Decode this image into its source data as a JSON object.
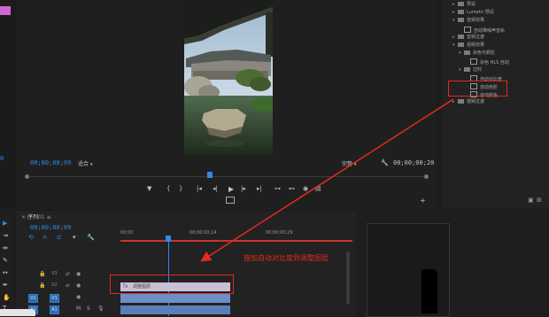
{
  "program": {
    "timecode_left": "00;00;00;09",
    "fit_label": "适合",
    "full_label": "完整",
    "timecode_right": "00;00;00;20"
  },
  "effects_panel": {
    "items": [
      {
        "indent": 1,
        "type": "folder",
        "label": "预设"
      },
      {
        "indent": 1,
        "type": "folder",
        "label": "Lumetri 预设"
      },
      {
        "indent": 1,
        "type": "folder-open",
        "label": "音频效果"
      },
      {
        "indent": 2,
        "type": "file",
        "label": "自动降噪声音轨"
      },
      {
        "indent": 1,
        "type": "folder",
        "label": "音频过渡"
      },
      {
        "indent": 1,
        "type": "folder-open",
        "label": "视频效果"
      },
      {
        "indent": 2,
        "type": "folder-open",
        "label": "杂色与颗粒"
      },
      {
        "indent": 3,
        "type": "file",
        "label": "杂色 HLS 自动"
      },
      {
        "indent": 2,
        "type": "folder-open",
        "label": "过时"
      },
      {
        "indent": 3,
        "type": "file",
        "label": "自动对比度"
      },
      {
        "indent": 3,
        "type": "file",
        "label": "自动色阶"
      },
      {
        "indent": 3,
        "type": "file",
        "label": "自动颜色"
      },
      {
        "indent": 1,
        "type": "folder",
        "label": "视频过渡"
      }
    ]
  },
  "timeline": {
    "sequence_name": "序列",
    "timecode": "00;00;00;09",
    "ruler": [
      "00;00",
      "00;00;00;14",
      "00;00;00;29"
    ],
    "tracks": [
      "V3",
      "V2",
      "V1",
      "A1"
    ],
    "adjustment_clip_label": "调整图层",
    "annotation": "施加自动对比度到调整图层"
  },
  "colors": {
    "accent_blue": "#2d8ceb",
    "highlight_red": "#e02b20",
    "adjustment_clip": "#c9c0d6",
    "video_clip": "#6d8fc7"
  }
}
